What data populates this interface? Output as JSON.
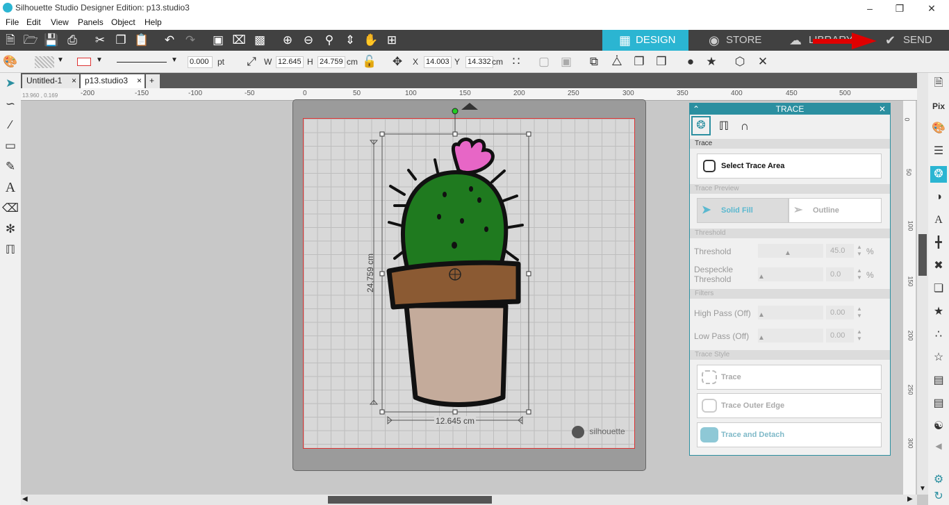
{
  "window": {
    "title": "Silhouette Studio Designer Edition: p13.studio3"
  },
  "menu": [
    "File",
    "Edit",
    "View",
    "Panels",
    "Object",
    "Help"
  ],
  "nav_tabs": {
    "design": "DESIGN",
    "store": "STORE",
    "library": "LIBRARY",
    "send": "SEND"
  },
  "line_style": {
    "width_value": "0.000",
    "unit": "pt"
  },
  "size": {
    "w_label": "W",
    "w_value": "12.645",
    "h_label": "H",
    "h_value": "24.759",
    "unit": "cm"
  },
  "position": {
    "x_label": "X",
    "x_value": "14.003",
    "y_label": "Y",
    "y_value": "14.332",
    "unit": "cm"
  },
  "doc_tabs": [
    {
      "label": "Untitled-1",
      "close": "×"
    },
    {
      "label": "p13.studio3",
      "close": "×"
    },
    {
      "label": "+"
    }
  ],
  "ruler": {
    "cursor_readout": "13.960 , 0.169",
    "h_labels": [
      "-200",
      "-150",
      "-100",
      "-50",
      "0",
      "50",
      "100",
      "150",
      "200",
      "250",
      "300",
      "350",
      "400",
      "450",
      "500"
    ],
    "v_labels": [
      "0",
      "50",
      "100",
      "150",
      "200",
      "250",
      "300"
    ]
  },
  "canvas": {
    "height_dim": "24,759 cm",
    "width_dim": "12.645 cm",
    "watermark": "silhouette"
  },
  "trace_panel": {
    "title": "TRACE",
    "section_trace": "Trace",
    "select_trace_area": "Select Trace Area",
    "section_preview": "Trace Preview",
    "solid_fill": "Solid Fill",
    "outline": "Outline",
    "section_threshold": "Threshold",
    "threshold_label": "Threshold",
    "threshold_value": "45.0",
    "despeckle_label": "Despeckle Threshold",
    "despeckle_value": "0.0",
    "pct": "%",
    "section_filters": "Filters",
    "high_pass_label": "High Pass (Off)",
    "high_pass_value": "0.00",
    "low_pass_label": "Low Pass (Off)",
    "low_pass_value": "0.00",
    "section_style": "Trace Style",
    "trace": "Trace",
    "trace_outer_edge": "Trace Outer Edge",
    "trace_detach": "Trace and Detach"
  },
  "colors": {
    "accent": "#2bb5d2",
    "dark_toolbar": "#414141",
    "trace_header": "#2b8fa0",
    "cutting_border": "#dd3333",
    "arrow": "#e00000"
  }
}
